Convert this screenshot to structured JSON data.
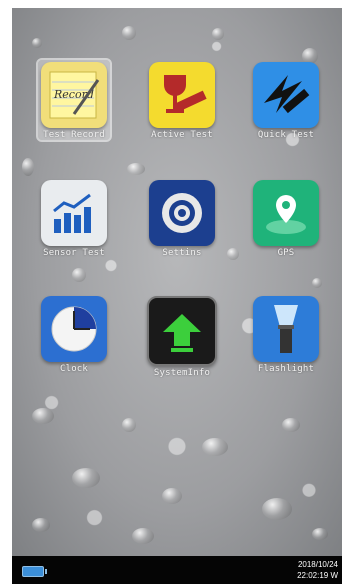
{
  "apps": [
    {
      "label": "Test Record",
      "icon": "record-icon",
      "bg": "#f1de7a"
    },
    {
      "label": "Active Test",
      "icon": "wine-glass-ruler-icon",
      "bg": "#f4db2e"
    },
    {
      "label": "Quick Test",
      "icon": "lightning-ruler-icon",
      "bg": "#2f8fe6"
    },
    {
      "label": "Sensor Test",
      "icon": "bar-chart-icon",
      "bg": "#e9ecef"
    },
    {
      "label": "Settins",
      "icon": "gear-icon",
      "bg": "#1c3f8f"
    },
    {
      "label": "GPS",
      "icon": "map-pin-icon",
      "bg": "#1fb37a"
    },
    {
      "label": "Clock",
      "icon": "clock-icon",
      "bg": "#2c6fd1"
    },
    {
      "label": "SystemInfo",
      "icon": "upload-arrow-icon",
      "bg": "#1a1a1a"
    },
    {
      "label": "Flashlight",
      "icon": "flashlight-icon",
      "bg": "#2d7cd8"
    }
  ],
  "record_text": "Record",
  "status": {
    "date": "2018/10/24",
    "time": "22:02:19 W"
  }
}
